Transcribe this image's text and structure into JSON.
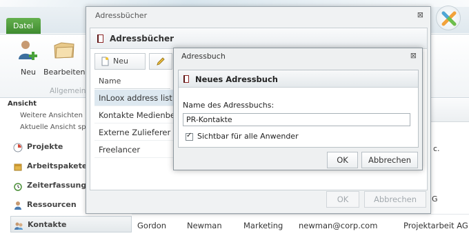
{
  "app": {
    "tab_datei": "Datei",
    "ribbon": {
      "neu_label": "Neu",
      "bearbeiten_label": "Bearbeiten",
      "group_label": "Allgemein"
    },
    "left_pane": {
      "heading": "Ansicht",
      "links": [
        "Weitere Ansichten",
        "Aktuelle Ansicht sp"
      ],
      "nav": [
        {
          "label": "Projekte",
          "icon": "projekte-icon"
        },
        {
          "label": "Arbeitspakete",
          "icon": "arbeitspakete-icon"
        },
        {
          "label": "Zeiterfassung",
          "icon": "zeiterfassung-icon"
        },
        {
          "label": "Ressourcen",
          "icon": "ressourcen-icon"
        },
        {
          "label": "Kontakte",
          "icon": "kontakte-icon"
        }
      ]
    },
    "grid_right": {
      "cells": [
        "c.",
        "G"
      ]
    },
    "row": {
      "first_name": "Gordon",
      "last_name": "Newman",
      "department": "Marketing",
      "email": "newman@corp.com",
      "group": "Projektarbeit AG"
    }
  },
  "dialog_addressbooks": {
    "title": "Adressbücher",
    "close_glyph": "⊠",
    "header": "Adressbücher",
    "toolbar": {
      "new_label": "Neu"
    },
    "list_header": "Name",
    "items": [
      "InLoox address list",
      "Kontakte Medienbe",
      "Externe Zulieferer",
      "Freelancer"
    ],
    "ok_label": "OK",
    "cancel_label": "Abbrechen"
  },
  "dialog_new_addressbook": {
    "title": "Adressbuch",
    "close_glyph": "⊠",
    "header": "Neues Adressbuch",
    "field_label": "Name des Adressbuchs:",
    "field_value": "PR-Kontakte",
    "checkbox_label": "Sichtbar für alle Anwender",
    "checkbox_checked": true,
    "ok_label": "OK",
    "cancel_label": "Abbrechen"
  },
  "colors": {
    "tab_green": "#4f9d3c",
    "selection_blue": "#dde8f0",
    "book_red": "#8b2323"
  }
}
